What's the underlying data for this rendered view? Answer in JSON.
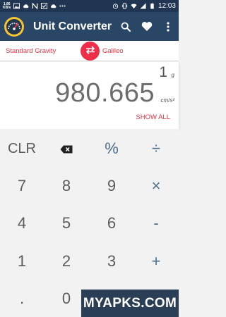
{
  "status_bar": {
    "speed_value": "1.86",
    "speed_unit": "KB/s",
    "time": "12:03"
  },
  "app_bar": {
    "title": "Unit Converter",
    "icons": [
      "speedometer-logo",
      "search-icon",
      "heart-icon",
      "more-vert-icon"
    ]
  },
  "units": {
    "from": "Standard Gravity",
    "to": "Galileo",
    "swap_icon": "swap-arrows-icon"
  },
  "display": {
    "input_value": "1",
    "input_unit": "g",
    "output_value": "980.665",
    "output_unit": "cm/s²",
    "show_all": "SHOW ALL"
  },
  "keypad": {
    "row1": [
      "CLR",
      "",
      "%",
      "÷"
    ],
    "row2": [
      "7",
      "8",
      "9",
      "×"
    ],
    "row3": [
      "4",
      "5",
      "6",
      "-"
    ],
    "row4": [
      "1",
      "2",
      "3",
      "+"
    ],
    "row5": [
      ".",
      "0"
    ]
  },
  "watermark": "MYAPKS.COM",
  "colors": {
    "status_bar": "#1f3552",
    "app_bar": "#2a4666",
    "accent": "#ef2f49",
    "operator": "#4a6e8e"
  }
}
